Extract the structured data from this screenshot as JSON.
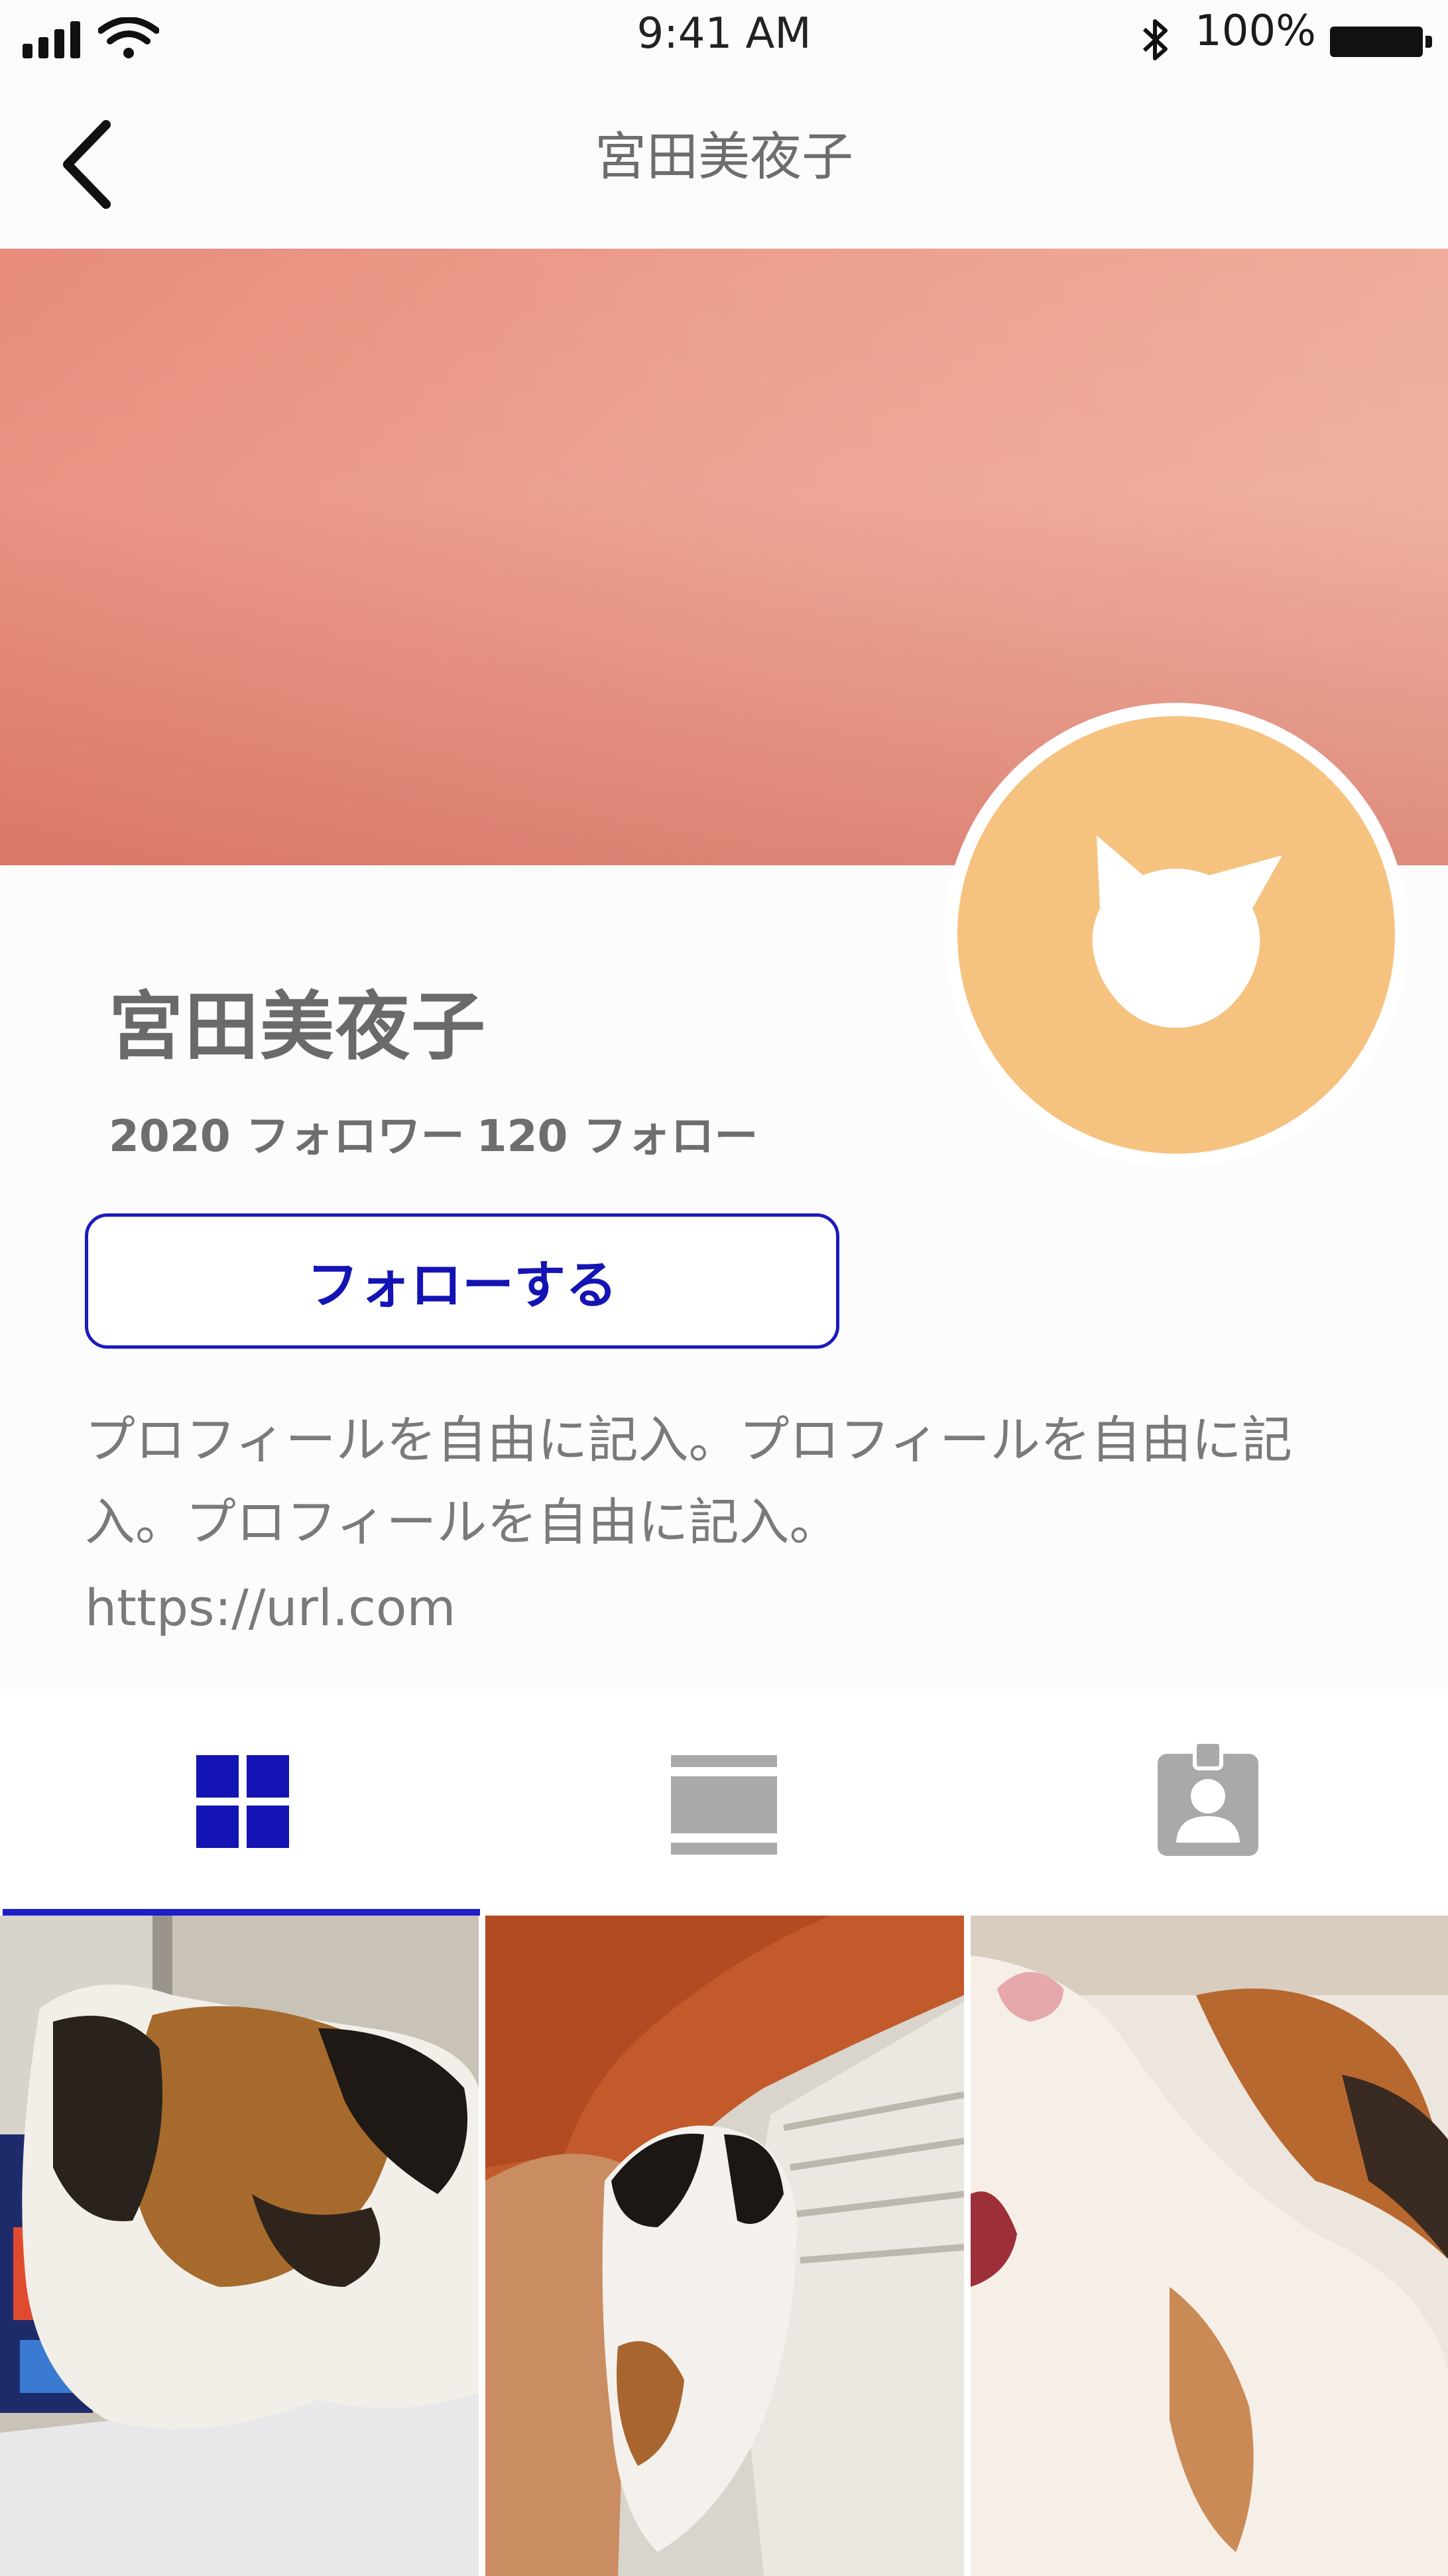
{
  "status_bar": {
    "time": "9:41 AM",
    "battery_percent": "100%",
    "icons": [
      "signal-icon",
      "wifi-icon",
      "bluetooth-icon",
      "battery-icon"
    ]
  },
  "nav": {
    "title": "宮田美夜子",
    "back_icon": "chevron-left-icon"
  },
  "profile": {
    "name": "宮田美夜子",
    "followers": "2020 フォロワー",
    "following": "120 フォロー",
    "follow_button_label": "フォローする",
    "bio": "プロフィールを自由に記入。プロフィールを自由に記入。プロフィールを自由に記入。",
    "link": "https://url.com",
    "avatar_icon": "cat-icon"
  },
  "tabs": [
    {
      "name": "grid",
      "icon": "grid-icon",
      "active": true
    },
    {
      "name": "list",
      "icon": "list-icon",
      "active": false
    },
    {
      "name": "tagged",
      "icon": "contact-badge-icon",
      "active": false
    }
  ],
  "photos": [
    {
      "subject": "calico cat on laptop"
    },
    {
      "subject": "calico cat under curtain"
    },
    {
      "subject": "calico cat face close-up"
    }
  ],
  "colors": {
    "accent": "#1e1ec8",
    "avatar_bg": "#f6c27f",
    "cover_start": "#e88c7c",
    "cover_end": "#efac9a",
    "icon_gray": "#a9a9a9"
  }
}
